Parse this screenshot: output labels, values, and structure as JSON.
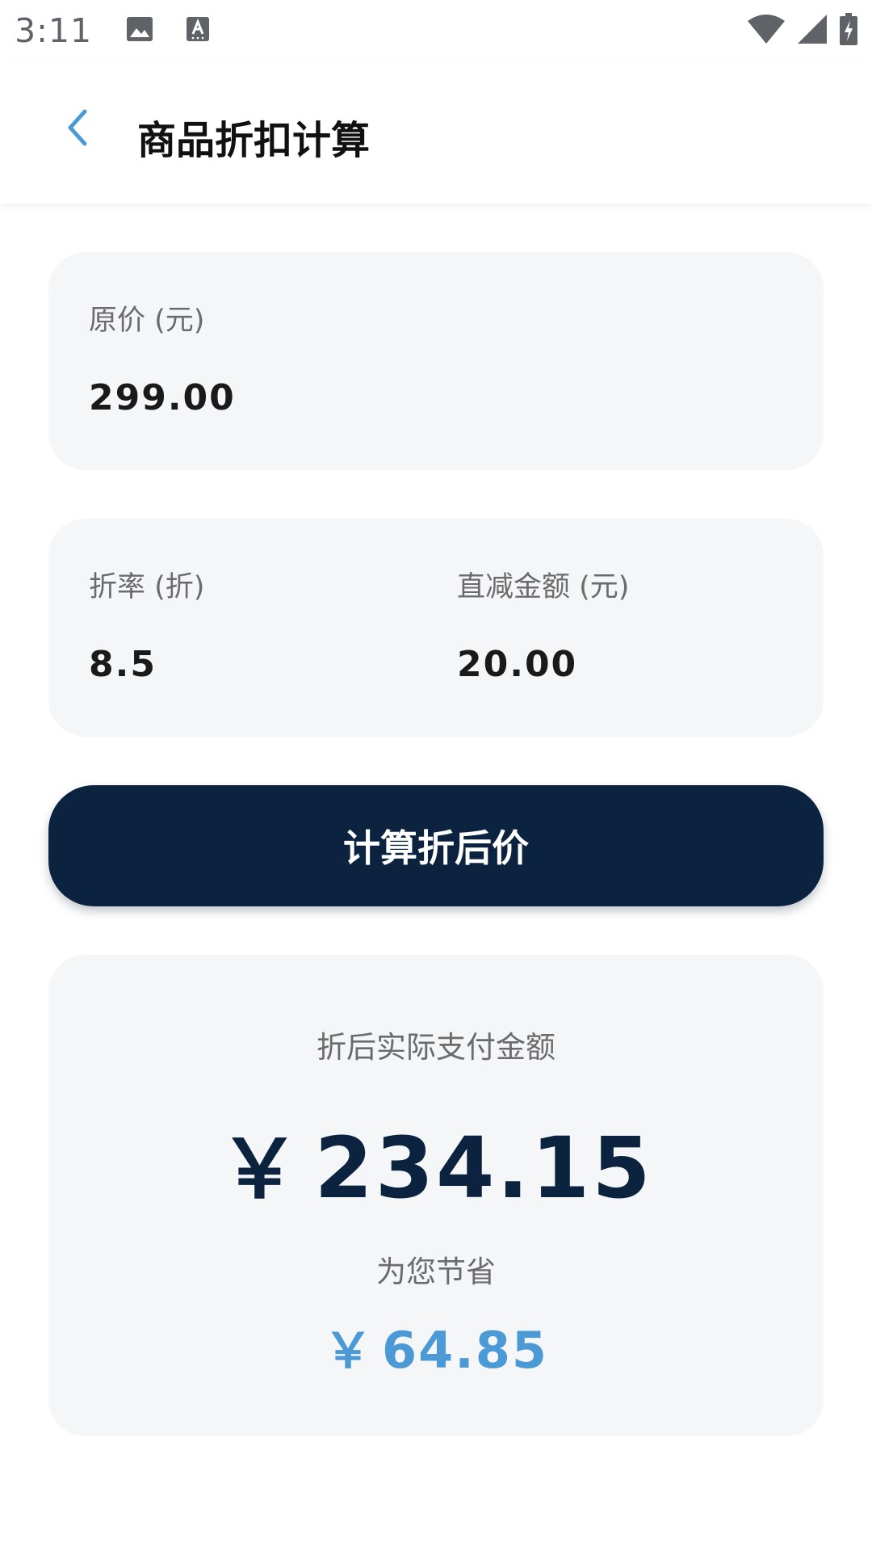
{
  "status_bar": {
    "time": "3:11",
    "icons": [
      "image-icon",
      "text-recognition-icon",
      "wifi-icon",
      "cellular-signal-icon",
      "battery-charging-icon"
    ]
  },
  "header": {
    "back_icon": "chevron-left-icon",
    "title": "商品折扣计算"
  },
  "form": {
    "original_price": {
      "label": "原价 (元)",
      "value": "299.00"
    },
    "discount_rate": {
      "label": "折率 (折)",
      "value": "8.5"
    },
    "direct_reduction": {
      "label": "直减金额 (元)",
      "value": "20.00"
    }
  },
  "calculate_button": {
    "label": "计算折后价"
  },
  "result": {
    "final_label": "折后实际支付金额",
    "final_currency": "￥",
    "final_amount": "234.15",
    "saving_label": "为您节省",
    "saving_currency": "￥",
    "saving_amount": "64.85"
  },
  "colors": {
    "primary": "#0c2340",
    "accent": "#4b9ad6",
    "card_bg": "#f5f6f8"
  }
}
